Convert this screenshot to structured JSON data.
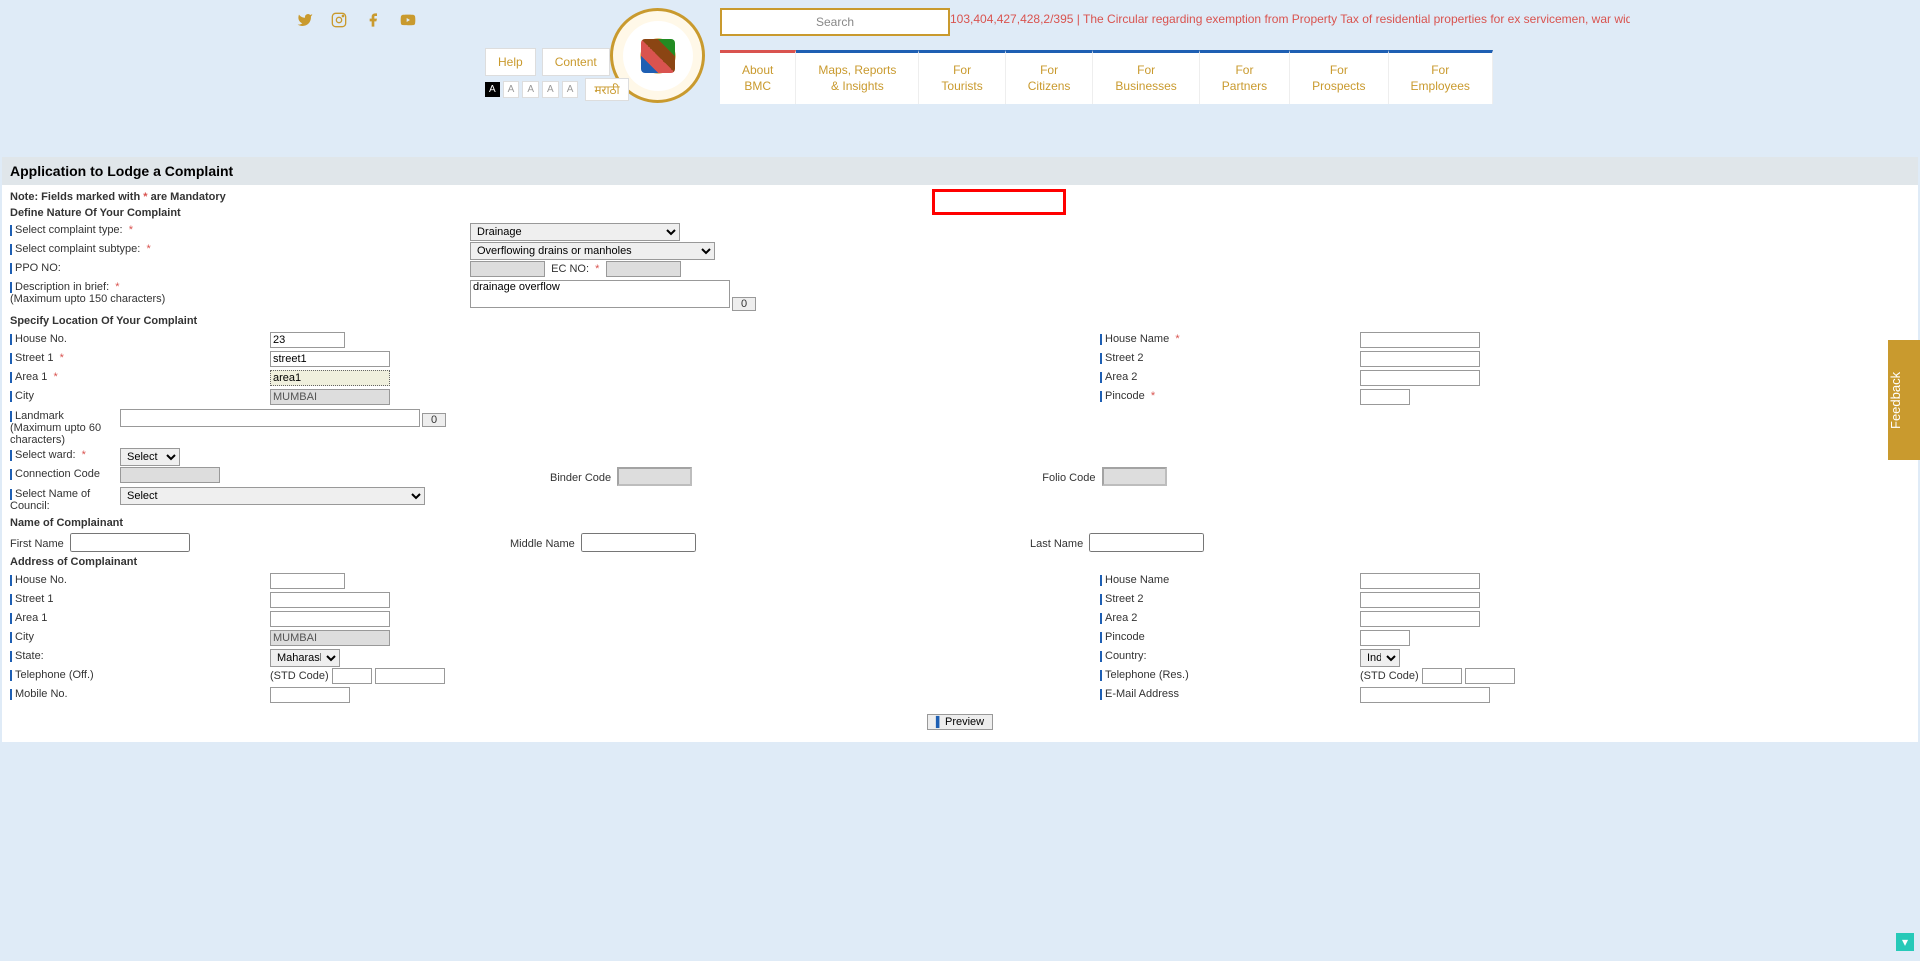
{
  "header": {
    "search_placeholder": "Search",
    "ticker": "103,404,427,428,2/395 | The Circular regarding exemption from Property Tax of residential properties for ex servicemen, war widow etc.",
    "help": "Help",
    "content": "Content",
    "lang": "मराठी",
    "font_a": "A"
  },
  "nav": [
    "About\nBMC",
    "Maps, Reports\n& Insights",
    "For\nTourists",
    "For\nCitizens",
    "For\nBusinesses",
    "For\nPartners",
    "For\nProspects",
    "For\nEmployees"
  ],
  "page": {
    "title": "Application to Lodge a Complaint",
    "note_prefix": "Note: Fields marked with ",
    "note_suffix": " are Mandatory"
  },
  "sec1": {
    "title": "Define Nature Of Your Complaint",
    "complaint_type_label": "Select complaint type:",
    "complaint_type_value": "Drainage",
    "complaint_subtype_label": "Select complaint subtype:",
    "complaint_subtype_value": "Overflowing drains or manholes",
    "ppo_label": "PPO NO:",
    "ec_label": "EC NO:",
    "desc_label": "Description in brief:",
    "desc_hint": "(Maximum upto 150 characters)",
    "desc_value": "drainage overflow",
    "desc_count": "0"
  },
  "sec2": {
    "title": "Specify Location Of Your Complaint",
    "house_no": "House No.",
    "house_no_val": "23",
    "house_name": "House Name",
    "street1": "Street 1",
    "street1_val": "street1",
    "street2": "Street 2",
    "area1": "Area 1",
    "area1_val": "area1",
    "area2": "Area 2",
    "city": "City",
    "city_val": "MUMBAI",
    "pincode": "Pincode",
    "landmark": "Landmark",
    "landmark_hint": "(Maximum upto 60 characters)",
    "landmark_count": "0",
    "ward": "Select ward:",
    "ward_val": "Select",
    "conn_code": "Connection Code",
    "binder_code": "Binder Code",
    "folio_code": "Folio Code",
    "council": "Select Name of Council:",
    "council_val": "Select"
  },
  "sec3": {
    "title": "Name of Complainant",
    "first": "First Name",
    "middle": "Middle Name",
    "last": "Last Name"
  },
  "sec4": {
    "title": "Address of Complainant",
    "house_no": "House No.",
    "house_name": "House Name",
    "street1": "Street 1",
    "street2": "Street 2",
    "area1": "Area 1",
    "area2": "Area 2",
    "city": "City",
    "city_val": "MUMBAI",
    "pincode": "Pincode",
    "state": "State:",
    "state_val": "Maharashtra",
    "country": "Country:",
    "country_val": "India",
    "tel_off": "Telephone (Off.)",
    "tel_res": "Telephone (Res.)",
    "std": "(STD Code)",
    "mobile": "Mobile No.",
    "email": "E-Mail Address"
  },
  "footer": {
    "preview": "Preview",
    "feedback": "Feedback"
  }
}
